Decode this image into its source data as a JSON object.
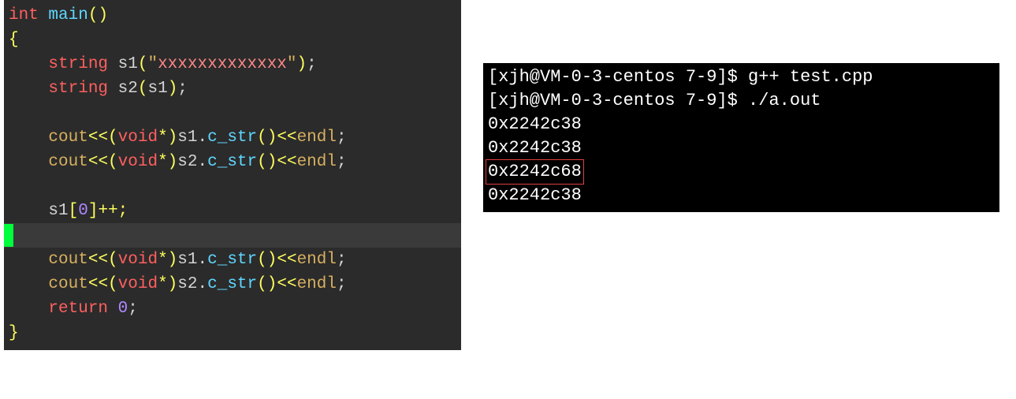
{
  "code": {
    "line1": {
      "type": "int",
      "func": "main",
      "parens": "()"
    },
    "line2": {
      "brace": "{"
    },
    "line3": {
      "indent": "    ",
      "type": "string",
      "ident": " s1",
      "p1": "(",
      "q1": "\"",
      "str": "xxxxxxxxxxxxx",
      "q2": "\"",
      "p2": ")",
      "semi": ";"
    },
    "line4": {
      "indent": "    ",
      "type": "string",
      "ident": " s2",
      "p1": "(",
      "arg": "s1",
      "p2": ")",
      "semi": ";"
    },
    "line5": {
      "blank": " "
    },
    "line6": {
      "indent": "    ",
      "cout": "cout",
      "op1": "<<(",
      "vtype": "void",
      "star": "*)",
      "obj": "s1.",
      "meth": "c_str",
      "call": "()",
      "op2": "<<",
      "endl": "endl",
      "semi": ";"
    },
    "line7": {
      "indent": "    ",
      "cout": "cout",
      "op1": "<<(",
      "vtype": "void",
      "star": "*)",
      "obj": "s2.",
      "meth": "c_str",
      "call": "()",
      "op2": "<<",
      "endl": "endl",
      "semi": ";"
    },
    "line8": {
      "blank": " "
    },
    "line9": {
      "indent": "    ",
      "ident": "s1",
      "br1": "[",
      "idx": "0",
      "br2": "]++;"
    },
    "line10": {
      "blank": " "
    },
    "line11": {
      "indent": "    ",
      "cout": "cout",
      "op1": "<<(",
      "vtype": "void",
      "star": "*)",
      "obj": "s1.",
      "meth": "c_str",
      "call": "()",
      "op2": "<<",
      "endl": "endl",
      "semi": ";"
    },
    "line12": {
      "indent": "    ",
      "cout": "cout",
      "op1": "<<(",
      "vtype": "void",
      "star": "*)",
      "obj": "s2.",
      "meth": "c_str",
      "call": "()",
      "op2": "<<",
      "endl": "endl",
      "semi": ";"
    },
    "line13": {
      "indent": "    ",
      "kw": "return",
      "sp": " ",
      "num": "0",
      "semi": ";"
    },
    "line14": {
      "brace": "}"
    }
  },
  "terminal": {
    "line1": "[xjh@VM-0-3-centos 7-9]$ g++ test.cpp",
    "line2": "[xjh@VM-0-3-centos 7-9]$ ./a.out",
    "line3": "0x2242c38",
    "line4": "0x2242c38",
    "line5": "0x2242c68",
    "line6": "0x2242c38"
  }
}
